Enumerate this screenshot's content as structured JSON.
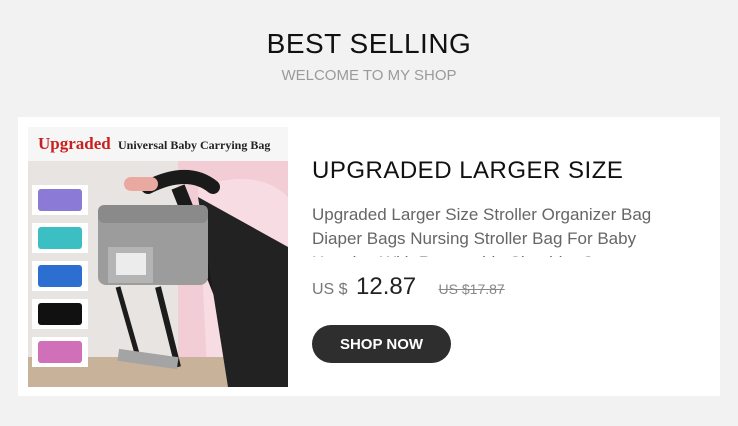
{
  "section": {
    "title": "BEST SELLING",
    "subtitle": "WELCOME TO MY SHOP"
  },
  "product": {
    "image": {
      "headline_red": "Upgraded",
      "headline_black": "Universal Baby Carrying Bag",
      "swatches": [
        "#8b7ad6",
        "#3bbfc3",
        "#2d6fd0",
        "#111111",
        "#d070b8"
      ]
    },
    "title": "UPGRADED LARGER SIZE",
    "description": "Upgraded Larger Size Stroller Organizer Bag Diaper Bags Nursing Stroller Bag For Baby Hanging With Removable Shoulder Strap",
    "currency": "US $",
    "price": "12.87",
    "old_price": "US $17.87",
    "button_label": "SHOP NOW"
  }
}
